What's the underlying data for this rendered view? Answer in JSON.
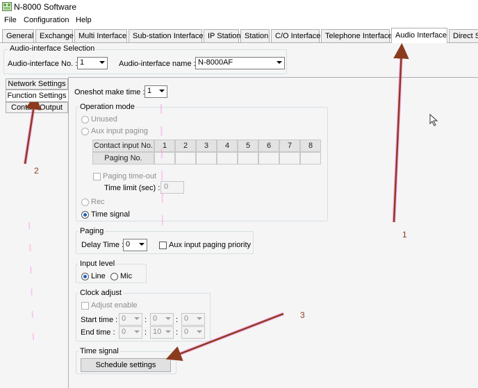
{
  "window": {
    "title": "N-8000 Software"
  },
  "menu": [
    "File",
    "Configuration",
    "Help"
  ],
  "tabs": [
    {
      "label": "General"
    },
    {
      "label": "Exchange"
    },
    {
      "label": "Multi Interface"
    },
    {
      "label": "Sub-station Interface"
    },
    {
      "label": "IP Station"
    },
    {
      "label": "Station"
    },
    {
      "label": "C/O Interface"
    },
    {
      "label": "Telephone Interface"
    },
    {
      "label": "Audio Interface",
      "active": true
    },
    {
      "label": "Direct Se"
    }
  ],
  "selection": {
    "group_label": "Audio-interface Selection",
    "no_label": "Audio-interface No. :",
    "no_value": "1",
    "name_label": "Audio-interface name :",
    "name_value": "N-8000AF"
  },
  "side_tabs": [
    {
      "label": "Network Settings"
    },
    {
      "label": "Function Settings",
      "active": true
    },
    {
      "label": "Contact Output"
    }
  ],
  "oneshot": {
    "label": "Oneshot make time :",
    "value": "1"
  },
  "operation": {
    "group_label": "Operation mode",
    "unused": "Unused",
    "aux_input_paging": "Aux input paging",
    "contact_header": "Contact input No.",
    "contact_numbers": [
      "1",
      "2",
      "3",
      "4",
      "5",
      "6",
      "7",
      "8"
    ],
    "paging_no_label": "Paging No.",
    "paging_timeout": "Paging time-out",
    "time_limit_label": "Time limit (sec) :",
    "time_limit_value": "0",
    "rec": "Rec",
    "time_signal": "Time signal",
    "selected": "Time signal"
  },
  "paging": {
    "group_label": "Paging",
    "delay_label": "Delay Time :",
    "delay_value": "0",
    "aux_priority": "Aux input paging priority"
  },
  "input_level": {
    "group_label": "Input level",
    "line": "Line",
    "mic": "Mic",
    "selected": "Line"
  },
  "clock_adjust": {
    "group_label": "Clock adjust",
    "adjust_enable": "Adjust enable",
    "start_label": "Start time :",
    "start": [
      "0",
      "0",
      "0"
    ],
    "end_label": "End time :",
    "end": [
      "0",
      "10",
      "0"
    ],
    "separator": ":"
  },
  "time_signal_group": {
    "group_label": "Time signal",
    "button": "Schedule settings"
  },
  "annotations": [
    "1",
    "2",
    "3"
  ],
  "colors": {
    "arrow": "#8b3a1e",
    "highlight": "#ff66dd",
    "active_radio": "#1f5fbf"
  }
}
